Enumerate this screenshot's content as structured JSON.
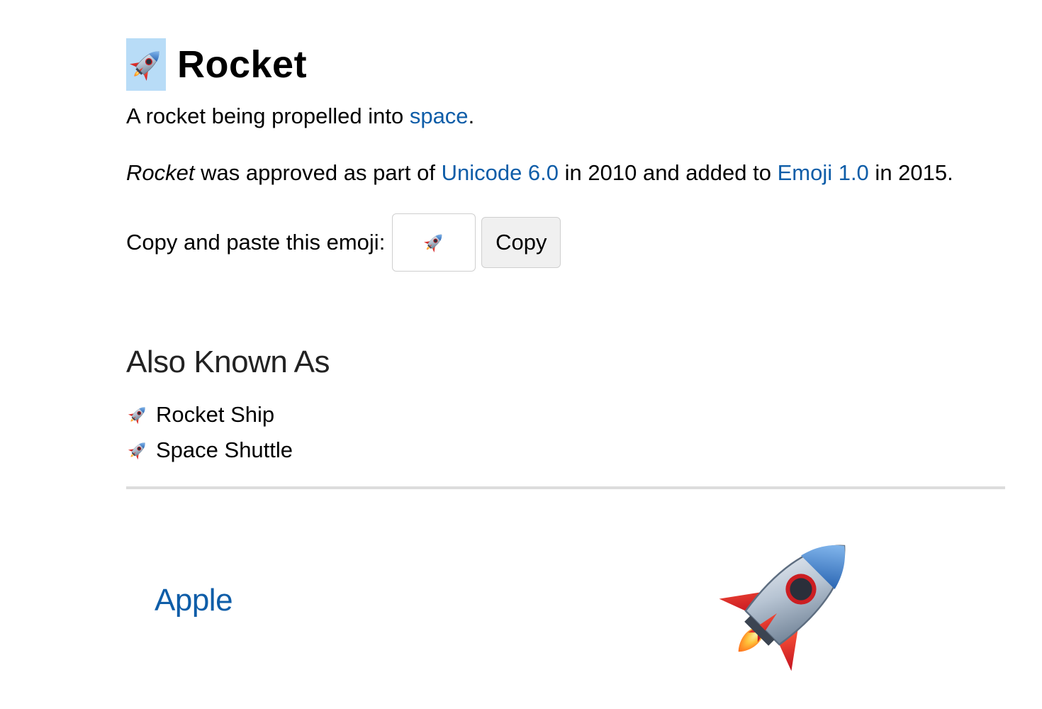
{
  "emoji": {
    "name": "Rocket",
    "glyph": "🚀",
    "icon": "rocket-icon"
  },
  "description": {
    "prefix": "A rocket being propelled into ",
    "link": "space",
    "suffix": "."
  },
  "approval": {
    "name": "Rocket",
    "text1": " was approved as part of ",
    "unicode_link": "Unicode 6.0",
    "text2": " in 2010 and added to ",
    "emoji_link": "Emoji 1.0",
    "text3": " in 2015."
  },
  "copy": {
    "label": "Copy and paste this emoji:",
    "value": "🚀",
    "button_label": "Copy"
  },
  "also_known_as": {
    "heading": "Also Known As",
    "items": [
      "Rocket Ship",
      "Space Shuttle"
    ]
  },
  "vendors": [
    {
      "name": "Apple"
    }
  ],
  "colors": {
    "link": "#0e5da8",
    "title_highlight": "#b8dcf7",
    "divider": "#dcdcdc"
  }
}
